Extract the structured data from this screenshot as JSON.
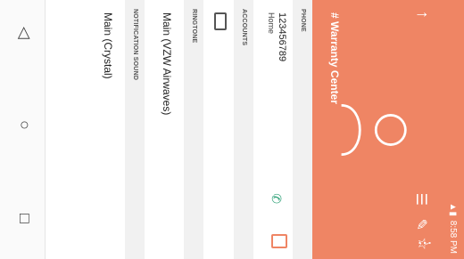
{
  "status": {
    "time": "8:58 PM"
  },
  "contact": {
    "name": "# Warranty Center"
  },
  "sections": {
    "phone": "PHONE",
    "accounts": "ACCOUNTS",
    "ringtone": "RINGTONE",
    "notification_sound": "NOTIFICATION SOUND"
  },
  "phone": {
    "number": "123456789",
    "type": "Home"
  },
  "ringtone": {
    "value": "Main (VZW Airwaves)"
  },
  "notification": {
    "value": "Main (Crystal)"
  },
  "icons": {
    "back": "arrow-up-icon",
    "edit_doc": "doc-icon",
    "edit": "pencil-icon",
    "favorite": "star-icon",
    "more": "overflow-icon",
    "call": "phone-icon",
    "message": "message-icon",
    "nav_back": "triangle-back-icon",
    "nav_home": "circle-home-icon",
    "nav_recents": "square-recents-icon"
  },
  "colors": {
    "accent": "#ef8564"
  }
}
